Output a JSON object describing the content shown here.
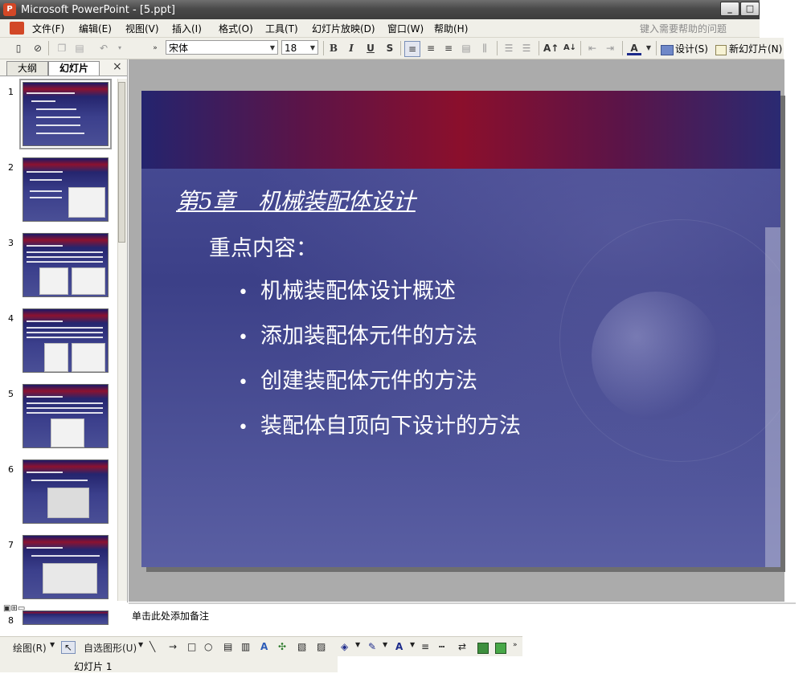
{
  "window": {
    "title": "Microsoft PowerPoint - [5.ppt]",
    "app_icon_label": "P",
    "minimize_label": "_",
    "maximize_label": "□"
  },
  "menubar": {
    "items": [
      "文件(F)",
      "编辑(E)",
      "视图(V)",
      "插入(I)",
      "格式(O)",
      "工具(T)",
      "幻灯片放映(D)",
      "窗口(W)",
      "帮助(H)"
    ],
    "help_placeholder": "键入需要帮助的问题"
  },
  "toolbar": {
    "font_name": "宋体",
    "font_size": "18",
    "bold": "B",
    "italic": "I",
    "underline": "U",
    "shadow": "S",
    "font_color": "A",
    "design_label": "设计(S)",
    "new_slide_label": "新幻灯片(N)"
  },
  "left_pane": {
    "tabs": [
      "大纲",
      "幻灯片"
    ],
    "close_label": "×",
    "slide_numbers": [
      "1",
      "2",
      "3",
      "4",
      "5",
      "6",
      "7",
      "8"
    ]
  },
  "slide": {
    "title": "第5章　机械装配体设计",
    "subtitle": "重点内容：",
    "bullet_glyph": "•",
    "bullets": [
      "机械装配体设计概述",
      "添加装配体元件的方法",
      "创建装配体元件的方法",
      "装配体自顶向下设计的方法"
    ]
  },
  "notes": {
    "placeholder": "单击此处添加备注"
  },
  "drawbar": {
    "draw_label": "绘图(R)",
    "autoshapes_label": "自选图形(U)"
  },
  "status": {
    "slide_indicator": "幻灯片 1"
  },
  "colors": {
    "slide_banner": "#8b0f2c",
    "slide_body": "#3c4088",
    "title_bar": "#4a4a4a"
  }
}
